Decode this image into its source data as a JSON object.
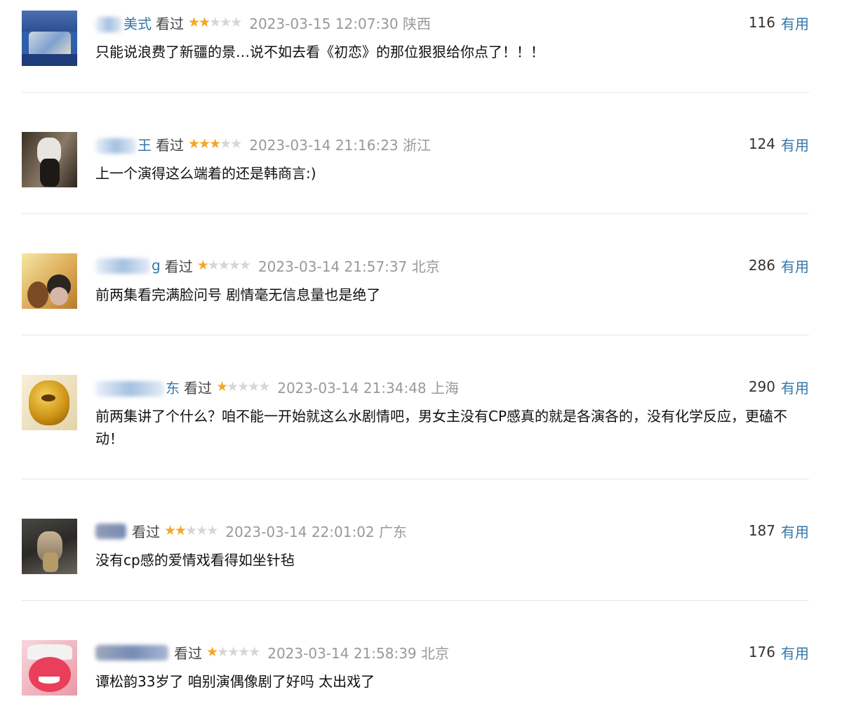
{
  "comments": [
    {
      "user_visible": "美式",
      "watched": "看过",
      "rating": 2,
      "time": "2023-03-15 12:07:30",
      "location": "陕西",
      "votes": "116",
      "vote_label": "有用",
      "text": "只能说浪费了新疆的景…说不如去看《初恋》的那位狠狠给你点了！！！"
    },
    {
      "user_visible": "王",
      "watched": "看过",
      "rating": 3,
      "time": "2023-03-14 21:16:23",
      "location": "浙江",
      "votes": "124",
      "vote_label": "有用",
      "text": "上一个演得这么端着的还是韩商言:)"
    },
    {
      "user_visible": "g",
      "watched": "看过",
      "rating": 1,
      "time": "2023-03-14 21:57:37",
      "location": "北京",
      "votes": "286",
      "vote_label": "有用",
      "text": "前两集看完满脸问号 剧情毫无信息量也是绝了"
    },
    {
      "user_visible": "东",
      "watched": "看过",
      "rating": 1,
      "time": "2023-03-14 21:34:48",
      "location": "上海",
      "votes": "290",
      "vote_label": "有用",
      "text": "前两集讲了个什么？咱不能一开始就这么水剧情吧，男女主没有CP感真的就是各演各的，没有化学反应，更磕不动！"
    },
    {
      "user_visible": "",
      "watched": "看过",
      "rating": 2,
      "time": "2023-03-14 22:01:02",
      "location": "广东",
      "votes": "187",
      "vote_label": "有用",
      "text": "没有cp感的爱情戏看得如坐针毡"
    },
    {
      "user_visible": "",
      "watched": "看过",
      "rating": 1,
      "time": "2023-03-14 21:58:39",
      "location": "北京",
      "votes": "176",
      "vote_label": "有用",
      "text": "谭松韵33岁了 咱别演偶像剧了好吗 太出戏了"
    }
  ],
  "colors": {
    "link": "#3377aa",
    "star_on": "#f6a623",
    "star_off": "#d6d6d6",
    "meta_gray": "#999999"
  }
}
